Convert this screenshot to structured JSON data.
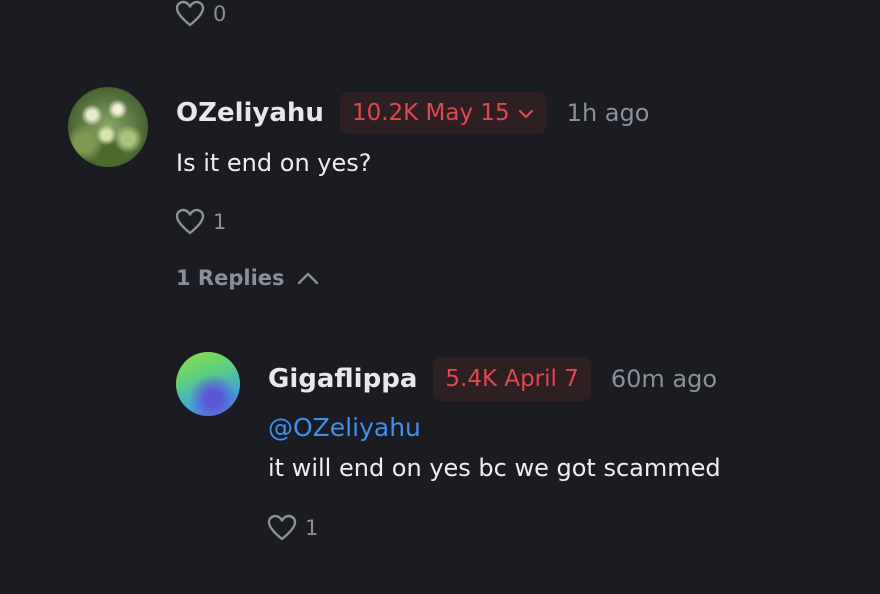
{
  "top_comment_partial": {
    "likes": "0",
    "icon": "heart-icon"
  },
  "comment": {
    "username": "OZeliyahu",
    "position_badge": "10.2K May 15",
    "badge_icon": "chevron-down-icon",
    "time": "1h ago",
    "text": "Is it end on yes?",
    "likes": "1",
    "replies_label": "1 Replies",
    "replies_icon": "chevron-up-icon"
  },
  "reply": {
    "username": "Gigaflippa",
    "position_badge": "5.4K April 7",
    "time": "60m ago",
    "mention": "@OZeliyahu",
    "text": "it will end on yes bc we got scammed",
    "likes": "1"
  },
  "colors": {
    "background": "#1b1c21",
    "badge_text": "#e0474f",
    "badge_bg": "#2e1f22",
    "mention": "#3f8ef0",
    "muted": "#8b8f99"
  }
}
